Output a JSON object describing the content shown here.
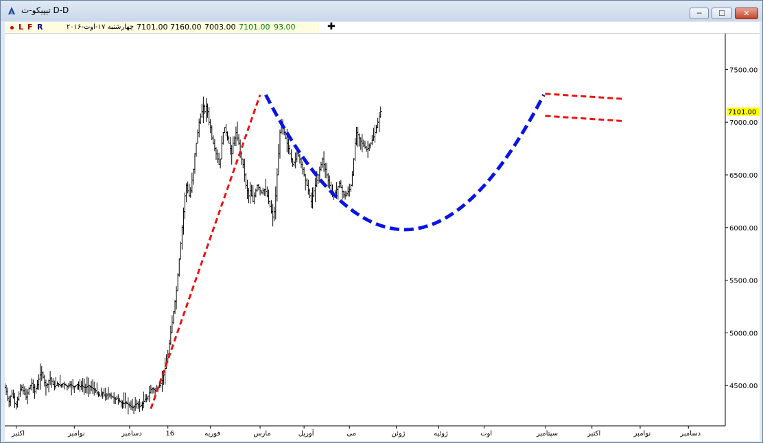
{
  "window": {
    "title": "تیپیکو-ت D-D",
    "min_label": "─",
    "max_label": "☐",
    "close_label": "✕"
  },
  "infobar": {
    "buttons": [
      "L",
      "F",
      "R"
    ],
    "date": "چهارشنبه ۱۷-اوت-۲۰۱۶",
    "open": "7101.00",
    "high": "7160.00",
    "low": "7003.00",
    "close": "7101.00",
    "volume": "93.00",
    "add_symbol": "✚"
  },
  "colors": {
    "background": "#ffffff",
    "price_bars": "#000000",
    "trend_red": "#ee1111",
    "cup_blue": "#0a14e6",
    "last_price_label": "#ffff00",
    "close_value_text": "#008000"
  },
  "chart_data": {
    "type": "ohlc_bar",
    "title": "",
    "xlabel": "",
    "ylabel": "",
    "ylim": [
      4200,
      7900
    ],
    "y_ticks": [
      4500,
      5000,
      5500,
      6000,
      6500,
      7000,
      7500
    ],
    "y_tick_labels": [
      "4500.00",
      "5000.00",
      "5500.00",
      "6000.00",
      "6500.00",
      "7000.00",
      "7500.00"
    ],
    "last_price_label": "7101.00",
    "x_tick_labels": [
      "اکتبر",
      "نوامبر",
      "دسامبر",
      "16",
      "فوریه",
      "مارس",
      "آوریل",
      "می",
      "ژوئن",
      "ژوئیه",
      "اوت",
      "سپتامبر",
      "اکتبر",
      "نوامبر",
      "دسامبر"
    ],
    "x_ticks_index": [
      8,
      49,
      88,
      115,
      145,
      180,
      211,
      243,
      276,
      306,
      338,
      381,
      414,
      448,
      482
    ],
    "x_index_range": [
      0,
      508
    ],
    "price_series": {
      "start_index": 0,
      "close": [
        4480,
        4440,
        4380,
        4350,
        4400,
        4420,
        4390,
        4330,
        4320,
        4370,
        4420,
        4460,
        4480,
        4450,
        4420,
        4390,
        4430,
        4470,
        4500,
        4520,
        4480,
        4440,
        4470,
        4510,
        4560,
        4600,
        4620,
        4580,
        4530,
        4500,
        4510,
        4550,
        4570,
        4540,
        4510,
        4490,
        4500,
        4520,
        4510,
        4500,
        4510,
        4520,
        4510,
        4500,
        4490,
        4500,
        4510,
        4500,
        4490,
        4490,
        4500,
        4510,
        4500,
        4490,
        4500,
        4490,
        4480,
        4480,
        4490,
        4500,
        4490,
        4480,
        4470,
        4460,
        4450,
        4430,
        4410,
        4400,
        4420,
        4430,
        4410,
        4400,
        4410,
        4420,
        4410,
        4400,
        4390,
        4380,
        4370,
        4380,
        4360,
        4350,
        4340,
        4330,
        4330,
        4340,
        4330,
        4320,
        4310,
        4300,
        4290,
        4300,
        4320,
        4330,
        4320,
        4300,
        4310,
        4330,
        4350,
        4370,
        4380,
        4400,
        4430,
        4460,
        4470,
        4460,
        4450,
        4460,
        4480,
        4500,
        4520,
        4550,
        4600,
        4660,
        4720,
        4800,
        4900,
        5000,
        5100,
        5200,
        5300,
        5400,
        5550,
        5700,
        5850,
        6000,
        6150,
        6300,
        6400,
        6350,
        6300,
        6350,
        6450,
        6550,
        6700,
        6800,
        6900,
        7000,
        7050,
        7100,
        7150,
        7100,
        7150,
        7100,
        7000,
        6950,
        6850,
        6800,
        6750,
        6700,
        6650,
        6600,
        6650,
        6800,
        6900,
        6950,
        6900,
        6850,
        6800,
        6750,
        6700,
        6800,
        6850,
        6900,
        6850,
        6800,
        6700,
        6650,
        6600,
        6500,
        6400,
        6350,
        6300,
        6350,
        6300,
        6250,
        6300,
        6350,
        6400,
        6380,
        6350,
        6330,
        6350,
        6360,
        6340,
        6300,
        6250,
        6200,
        6150,
        6100,
        6150,
        6300,
        6500,
        6700,
        6900,
        7000,
        6950,
        6900,
        6850,
        6800,
        6750,
        6700,
        6650,
        6600,
        6620,
        6650,
        6700,
        6680,
        6650,
        6600,
        6550,
        6500,
        6450,
        6400,
        6350,
        6300,
        6250,
        6300,
        6350,
        6400,
        6450,
        6500,
        6550,
        6600,
        6650,
        6600,
        6550,
        6500,
        6450,
        6400,
        6350,
        6320,
        6300,
        6330,
        6360,
        6390,
        6420,
        6380,
        6340,
        6310,
        6300,
        6320,
        6340,
        6360,
        6400,
        6500,
        6650,
        6800,
        6900,
        6880,
        6850,
        6820,
        6800,
        6780,
        6760,
        6740,
        6750,
        6780,
        6800,
        6830,
        6860,
        6900,
        6950,
        7000,
        7050,
        7101
      ]
    }
  }
}
